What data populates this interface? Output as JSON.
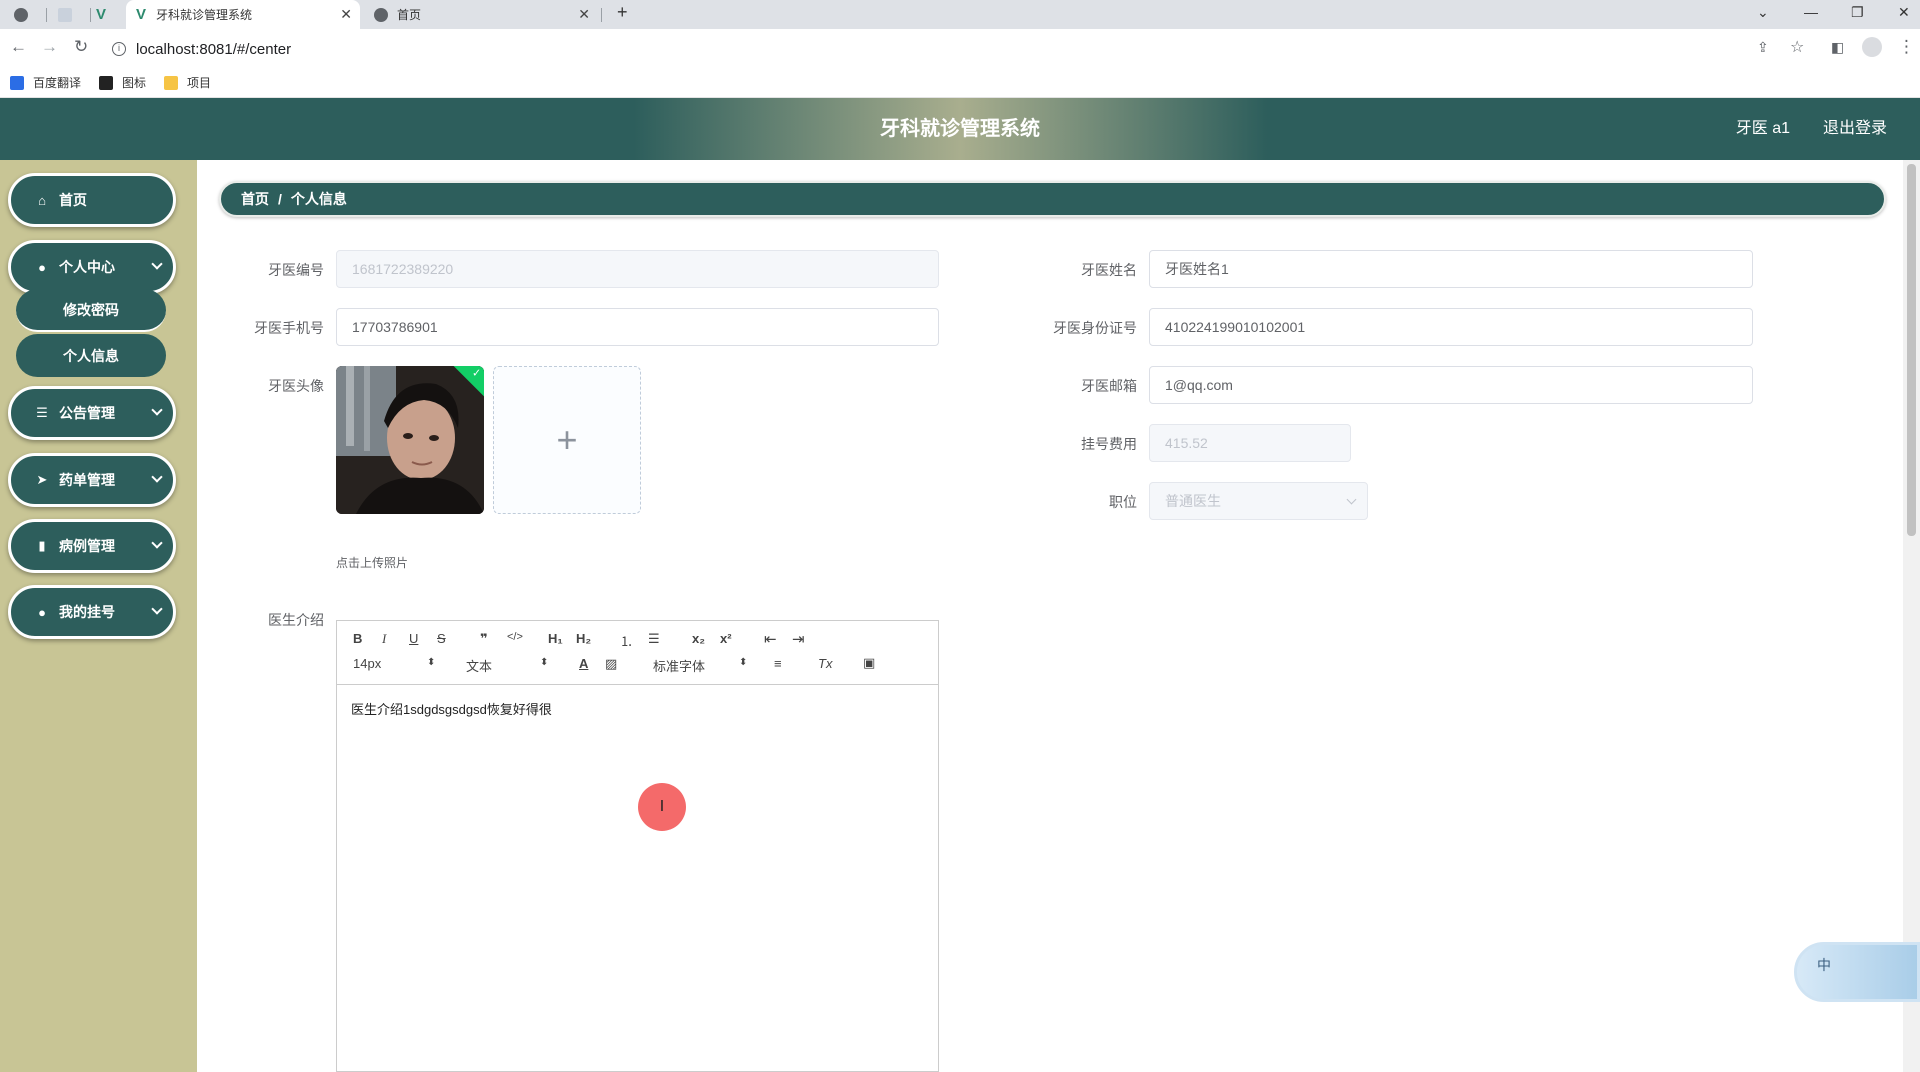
{
  "browser": {
    "tabs": [
      {
        "title": "",
        "active": false
      },
      {
        "title": "",
        "active": false
      },
      {
        "title": "",
        "active": false
      },
      {
        "title": "牙科就诊管理系统",
        "active": true
      },
      {
        "title": "首页",
        "active": false
      }
    ],
    "new_tab_symbol": "+",
    "url": "localhost:8081/#/center",
    "bookmarks": [
      {
        "label": "百度翻译",
        "icon": "baidu-translate-icon"
      },
      {
        "label": "图标",
        "icon": "flag-icon"
      },
      {
        "label": "项目",
        "icon": "folder-icon"
      }
    ]
  },
  "header": {
    "title": "牙科就诊管理系统",
    "user": "牙医 a1",
    "logout": "退出登录"
  },
  "sidebar": {
    "items": [
      {
        "label": "首页",
        "icon": "home-icon",
        "has_children": false
      },
      {
        "label": "个人中心",
        "icon": "user-icon",
        "has_children": true,
        "expanded": true,
        "children": [
          {
            "label": "修改密码"
          },
          {
            "label": "个人信息"
          }
        ]
      },
      {
        "label": "公告管理",
        "icon": "list-icon",
        "has_children": true
      },
      {
        "label": "药单管理",
        "icon": "send-icon",
        "has_children": true
      },
      {
        "label": "病例管理",
        "icon": "bar-chart-icon",
        "has_children": true
      },
      {
        "label": "我的挂号",
        "icon": "location-icon",
        "has_children": true
      }
    ]
  },
  "breadcrumb": {
    "home": "首页",
    "separator": "/",
    "current": "个人信息"
  },
  "form": {
    "dentist_id": {
      "label": "牙医编号",
      "value": "1681722389220",
      "disabled": true
    },
    "dentist_name": {
      "label": "牙医姓名",
      "value": "牙医姓名1"
    },
    "phone": {
      "label": "牙医手机号",
      "value": "17703786901"
    },
    "id_card": {
      "label": "牙医身份证号",
      "value": "410224199010102001"
    },
    "avatar": {
      "label": "牙医头像",
      "upload_tip": "点击上传照片",
      "upload_symbol": "+"
    },
    "email": {
      "label": "牙医邮箱",
      "value": "1@qq.com"
    },
    "fee": {
      "label": "挂号费用",
      "value": "415.52",
      "disabled": true
    },
    "position": {
      "label": "职位",
      "value": "普通医生",
      "disabled": true
    },
    "intro": {
      "label": "医生介绍",
      "content": "医生介绍1sdgdsgsdgsd恢复好得很"
    }
  },
  "editor_toolbar": {
    "bold": "B",
    "italic": "I",
    "underline": "U",
    "strike": "S",
    "quote": "❞",
    "code": "</>",
    "h1": "H₁",
    "h2": "H₂",
    "ordered_list": "⒈",
    "bullet_list": "☰",
    "subscript": "x₂",
    "superscript": "x²",
    "outdent": "⇤",
    "indent": "⇥",
    "size": "14px",
    "header": "文本",
    "font": "标准字体",
    "align": "≡",
    "clean": "Tx",
    "image": "▣"
  },
  "colors": {
    "primary": "#2d5e5c",
    "sidebar_bg": "#c8c595",
    "header_highlight": "#a9ae8e"
  }
}
